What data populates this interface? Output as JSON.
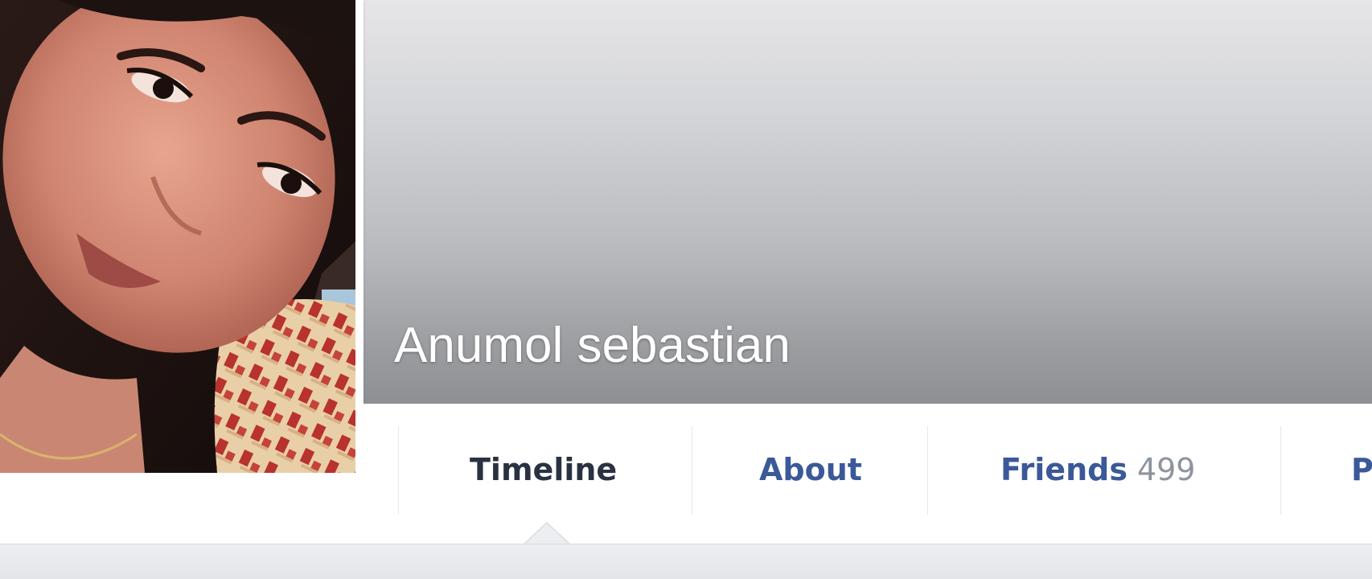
{
  "profile": {
    "name": "Anumol sebastian"
  },
  "cover": {
    "watermark_icon": "amazon-smile-logo-icon"
  },
  "tabs": [
    {
      "label": "Timeline",
      "active": true
    },
    {
      "label": "About",
      "active": false
    },
    {
      "label": "Friends",
      "count": "499",
      "active": false
    },
    {
      "label": "P",
      "active": false
    }
  ],
  "colors": {
    "link": "#3b5998",
    "active_tab": "#2a3242",
    "count": "#8d949e"
  }
}
